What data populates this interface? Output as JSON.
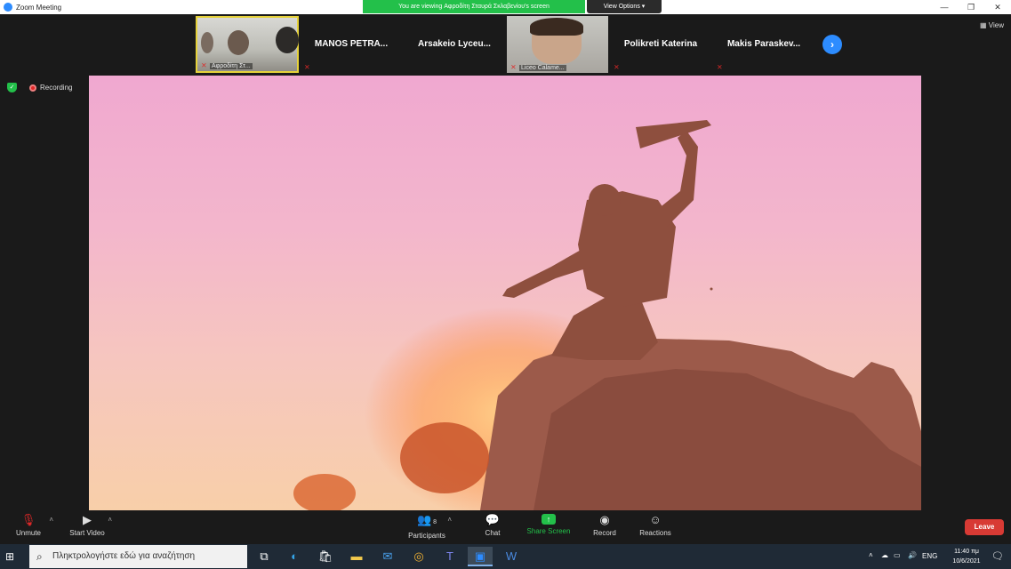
{
  "window": {
    "title": "Zoom Meeting",
    "controls": [
      "—",
      "❐",
      "✕"
    ]
  },
  "share_banner": {
    "text": "You are viewing Αφροδίτη Σταυρά Σκλαβενίου's screen",
    "view_options": "View Options ▾"
  },
  "participants": [
    {
      "name": "Αφροδίτη Στ...",
      "type": "video",
      "muted": true
    },
    {
      "name": "MANOS PETRA...",
      "type": "name",
      "muted": true
    },
    {
      "name": "Arsakeio Lyceu...",
      "type": "name",
      "muted": false
    },
    {
      "name": "Liceo Calame...",
      "type": "video",
      "muted": true
    },
    {
      "name": "Polikreti Katerina",
      "type": "name",
      "muted": true
    },
    {
      "name": "Makis Paraskev...",
      "type": "name",
      "muted": true
    }
  ],
  "next_page_icon": "chevron-right",
  "view_label": "View",
  "recording_label": "Recording",
  "toolbar": {
    "unmute": "Unmute",
    "start_video": "Start Video",
    "participants": "Participants",
    "participants_count": "8",
    "chat": "Chat",
    "share_screen": "Share Screen",
    "record": "Record",
    "reactions": "Reactions",
    "leave": "Leave"
  },
  "taskbar": {
    "search_placeholder": "Πληκτρολογήστε εδώ για αναζήτηση",
    "language": "ENG",
    "time": "11:40 πμ",
    "date": "10/6/2021"
  },
  "colors": {
    "zoom_blue": "#2d8cff",
    "banner_green": "#23c04a",
    "leave_red": "#d83a34",
    "mute_red": "#e02828"
  }
}
